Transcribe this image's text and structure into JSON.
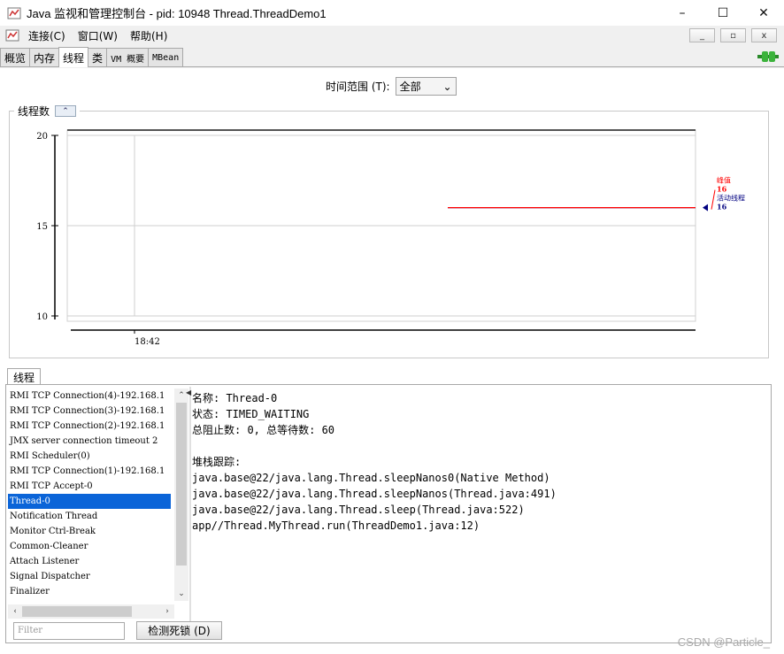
{
  "window": {
    "title": "Java 监视和管理控制台 - pid: 10948 Thread.ThreadDemo1",
    "minimize_glyph": "–",
    "maximize_glyph": "☐",
    "close_glyph": "✕"
  },
  "menu": {
    "items": [
      "连接(C)",
      "窗口(W)",
      "帮助(H)"
    ],
    "inner_minimize_glyph": "_",
    "inner_restore_glyph": "▫",
    "inner_close_glyph": "x"
  },
  "tabs": [
    {
      "label": "概览",
      "active": false
    },
    {
      "label": "内存",
      "active": false
    },
    {
      "label": "线程",
      "active": true
    },
    {
      "label": "类",
      "active": false
    },
    {
      "label": "VM 概要",
      "active": false
    },
    {
      "label": "MBean",
      "active": false
    }
  ],
  "time_range": {
    "label": "时间范围 (T):",
    "selected": "全部",
    "arrow_glyph": "⌄"
  },
  "chart_panel": {
    "title": "线程数",
    "collapse_glyph": "⌃"
  },
  "chart_data": {
    "type": "line",
    "title": "",
    "xlabel": "",
    "ylabel": "",
    "ylim": [
      10,
      20
    ],
    "y_ticks": [
      10,
      15,
      20
    ],
    "x_ticks": [
      "18:42"
    ],
    "grid": true,
    "legend_position": "right",
    "series": [
      {
        "name": "峰值",
        "color": "#ff0000",
        "values": [
          16
        ]
      },
      {
        "name": "活动线程",
        "color": "#000080",
        "values": [
          16
        ]
      }
    ],
    "legend": [
      {
        "name": "峰值",
        "value": "16",
        "color": "#ff0000"
      },
      {
        "name": "活动线程",
        "value": "16",
        "color": "#000080"
      }
    ]
  },
  "threads_section": {
    "tab_label": "线程",
    "list": [
      "RMI TCP Connection(4)-192.168.1",
      "RMI TCP Connection(3)-192.168.1",
      "RMI TCP Connection(2)-192.168.1",
      "JMX server connection timeout 2",
      "RMI Scheduler(0)",
      "RMI TCP Connection(1)-192.168.1",
      "RMI TCP Accept-0",
      "Thread-0",
      "Notification Thread",
      "Monitor Ctrl-Break",
      "Common-Cleaner",
      "Attach Listener",
      "Signal Dispatcher",
      "Finalizer"
    ],
    "selected_index": 7,
    "detail": {
      "name_line": "名称: Thread-0",
      "state_line": "状态: TIMED_WAITING",
      "counts_line": "总阻止数: 0, 总等待数: 60",
      "stack_title": "堆栈跟踪:",
      "stack": [
        "java.base@22/java.lang.Thread.sleepNanos0(Native Method)",
        "java.base@22/java.lang.Thread.sleepNanos(Thread.java:491)",
        "java.base@22/java.lang.Thread.sleep(Thread.java:522)",
        "app//Thread.MyThread.run(ThreadDemo1.java:12)"
      ]
    },
    "filter_placeholder": "Filter",
    "detect_button": "检测死锁 (D)"
  },
  "watermark": "CSDN @Particle_"
}
